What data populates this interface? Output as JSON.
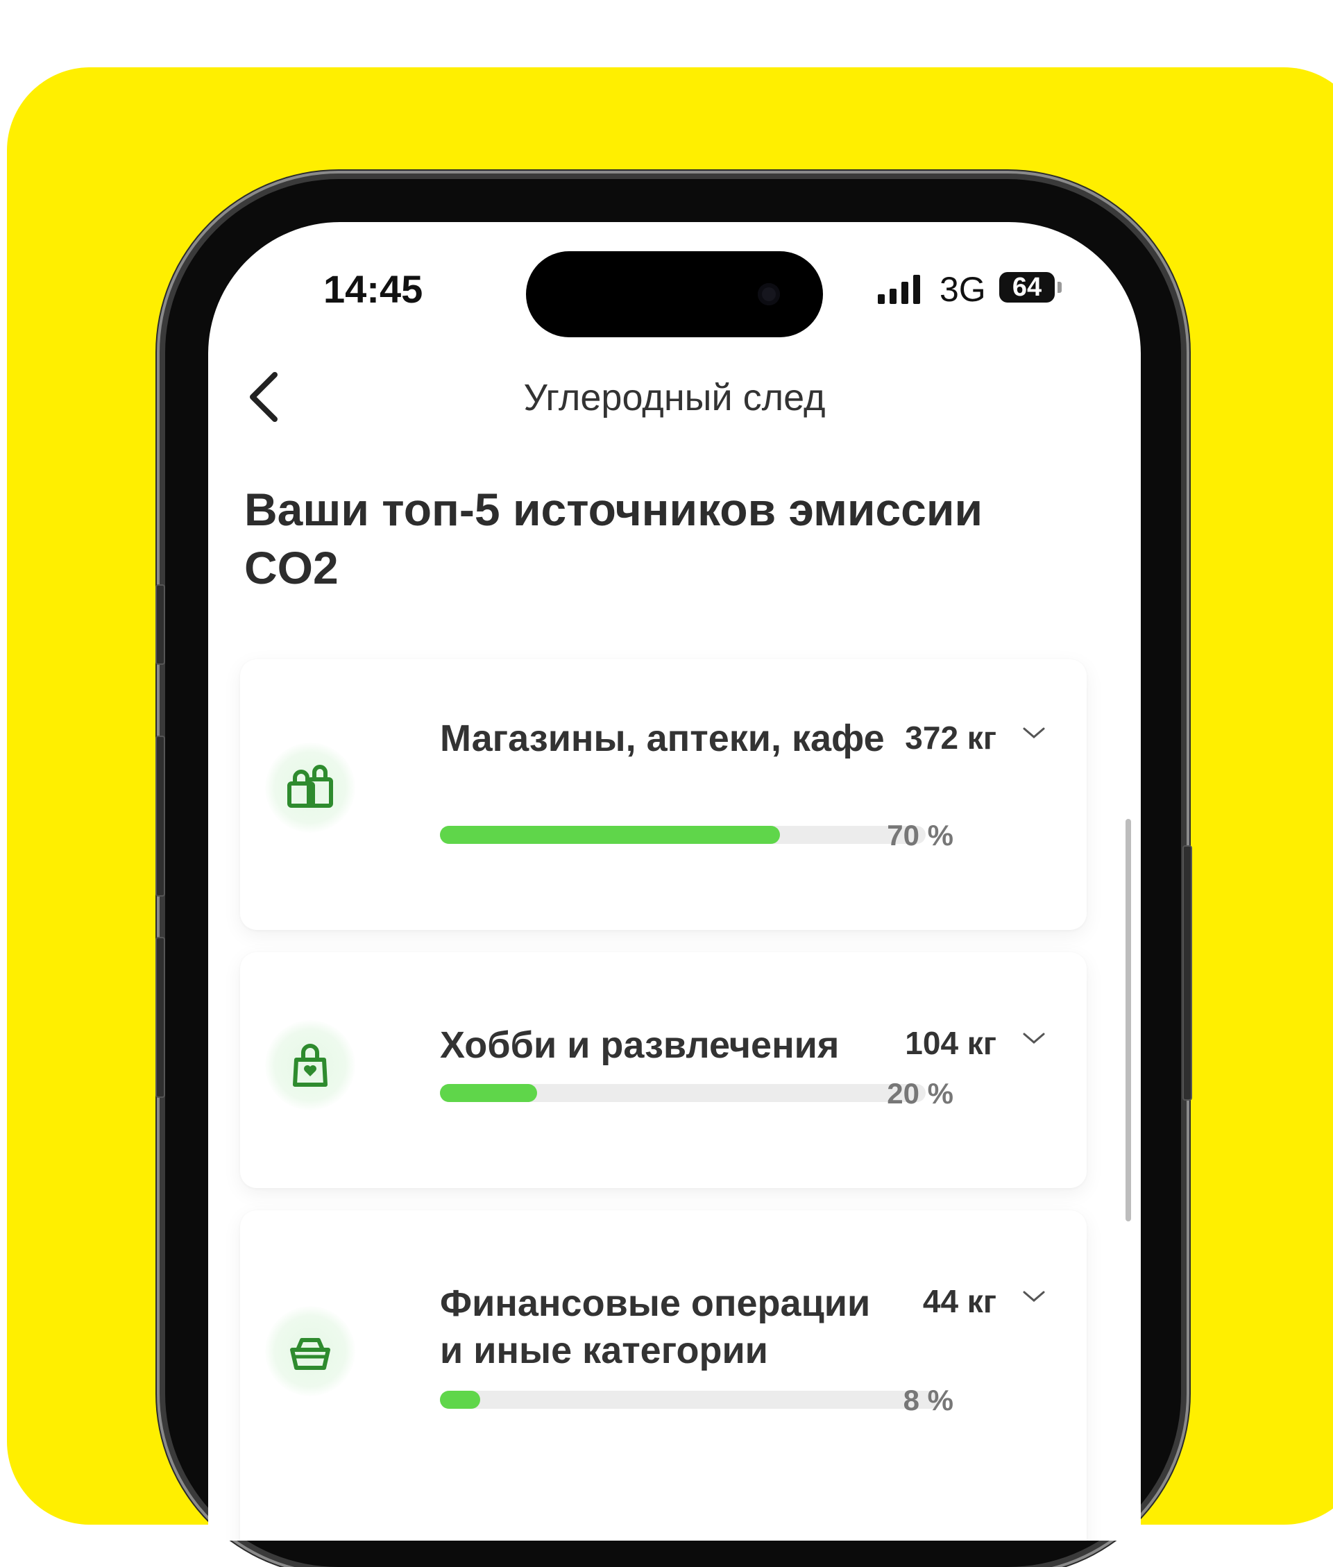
{
  "status_bar": {
    "time": "14:45",
    "network": "3G",
    "battery": "64"
  },
  "nav": {
    "back_icon": "chevron-left-icon",
    "title": "Углеродный след"
  },
  "section_title": "Ваши топ-5 источников эмиссии CO2",
  "colors": {
    "background_accent": "#FFEF00",
    "progress_fill": "#5FD64A",
    "icon_green": "#2E8B2E"
  },
  "categories": [
    {
      "name": "Магазины, аптеки, кафе",
      "value": "372 кг",
      "percent_label": "70 %",
      "percent": 70,
      "icon": "shopping-bags-icon"
    },
    {
      "name": "Хобби и развлечения",
      "value": "104 кг",
      "percent_label": "20 %",
      "percent": 20,
      "icon": "bag-heart-icon"
    },
    {
      "name": "Финансовые операции и иные категории",
      "value": "44 кг",
      "percent_label": "8 %",
      "percent": 8,
      "icon": "basket-icon"
    }
  ]
}
